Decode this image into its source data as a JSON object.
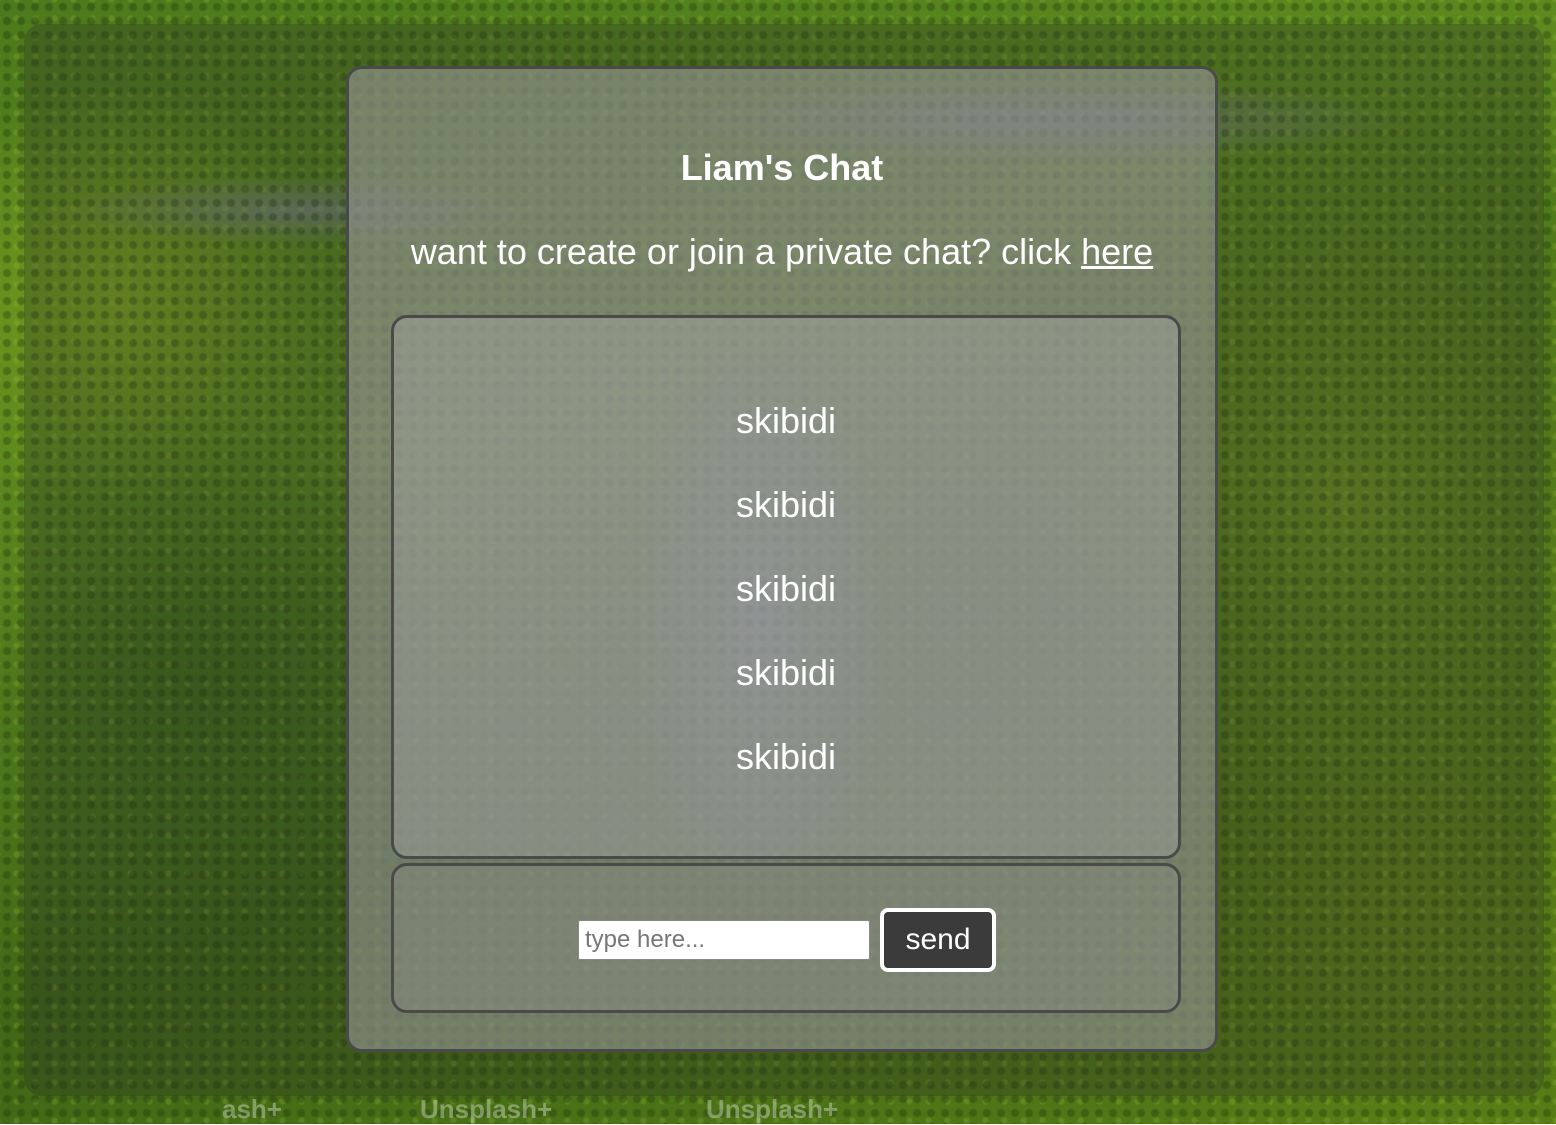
{
  "app": {
    "title": "Liam's Chat",
    "subtitle_prefix": "want to create or join a private chat? click ",
    "subtitle_link": "here"
  },
  "messages": [
    {
      "text": "skibidi"
    },
    {
      "text": "skibidi"
    },
    {
      "text": "skibidi"
    },
    {
      "text": "skibidi"
    },
    {
      "text": "skibidi"
    }
  ],
  "composer": {
    "input_value": "",
    "input_placeholder": "type here...",
    "send_label": "send"
  },
  "background": {
    "watermark_text": [
      "ash+",
      "Unsplash+",
      "Unsplash+"
    ]
  },
  "colors": {
    "panel_border": "#4a4a4a",
    "button_bg": "#3b3b3b",
    "text": "#ffffff"
  }
}
